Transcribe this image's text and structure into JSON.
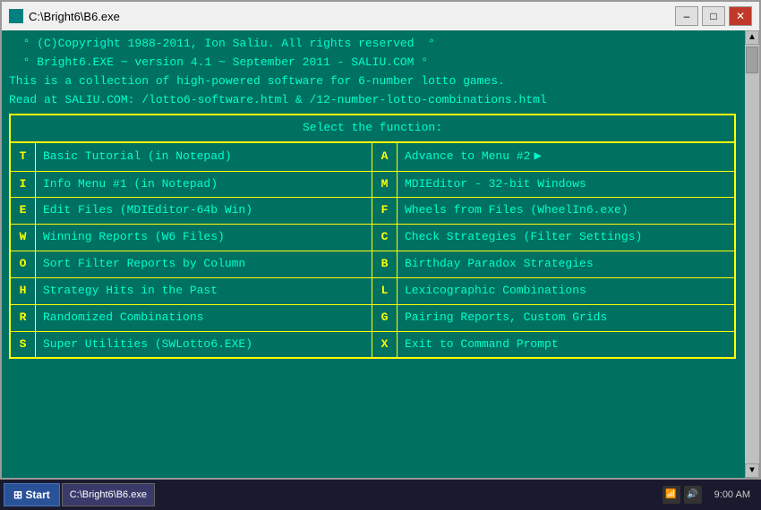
{
  "window": {
    "title": "C:\\Bright6\\B6.exe",
    "minimize_label": "–",
    "maximize_label": "□",
    "close_label": "✕"
  },
  "terminal": {
    "header_lines": [
      "  ° (C)Copyright 1988-2011, Ion Saliu. All rights reserved  °",
      "  ° Bright6.EXE ~ version 4.1 ~ September 2011 - SALIU.COM °",
      "This is a collection of high-powered software for 6-number lotto games.",
      "Read at SALIU.COM: /lotto6-software.html & /12-number-lotto-combinations.html"
    ],
    "menu_title": "Select the function:",
    "menu_items": [
      {
        "key": "T",
        "label": "Basic Tutorial (in Notepad)",
        "side": "left"
      },
      {
        "key": "A",
        "label": "Advance to Menu #2",
        "arrow": true,
        "side": "right"
      },
      {
        "key": "I",
        "label": "Info Menu #1 (in Notepad)",
        "side": "left"
      },
      {
        "key": "M",
        "label": "MDIEditor - 32-bit Windows",
        "side": "right"
      },
      {
        "key": "E",
        "label": "Edit Files (MDIEditor-64b Win)",
        "side": "left"
      },
      {
        "key": "F",
        "label": "Wheels from Files (WheelIn6.exe)",
        "side": "right"
      },
      {
        "key": "W",
        "label": "Winning Reports (W6 Files)",
        "side": "left"
      },
      {
        "key": "C",
        "label": "Check Strategies (Filter Settings)",
        "side": "right"
      },
      {
        "key": "O",
        "label": "Sort Filter Reports by Column",
        "side": "left"
      },
      {
        "key": "B",
        "label": "Birthday Paradox Strategies",
        "side": "right"
      },
      {
        "key": "H",
        "label": "Strategy Hits in the Past",
        "side": "left"
      },
      {
        "key": "L",
        "label": "Lexicographic Combinations",
        "side": "right"
      },
      {
        "key": "R",
        "label": "Randomized Combinations",
        "side": "left"
      },
      {
        "key": "G",
        "label": "Pairing Reports, Custom Grids",
        "side": "right"
      },
      {
        "key": "S",
        "label": "Super Utilities (SWLotto6.EXE)",
        "side": "left"
      },
      {
        "key": "X",
        "label": "Exit to Command Prompt",
        "side": "right"
      }
    ]
  },
  "taskbar": {
    "start_label": "⊞ Start",
    "active_item": "C:\\Bright6\\B6.exe",
    "clock": "9:00 AM"
  }
}
